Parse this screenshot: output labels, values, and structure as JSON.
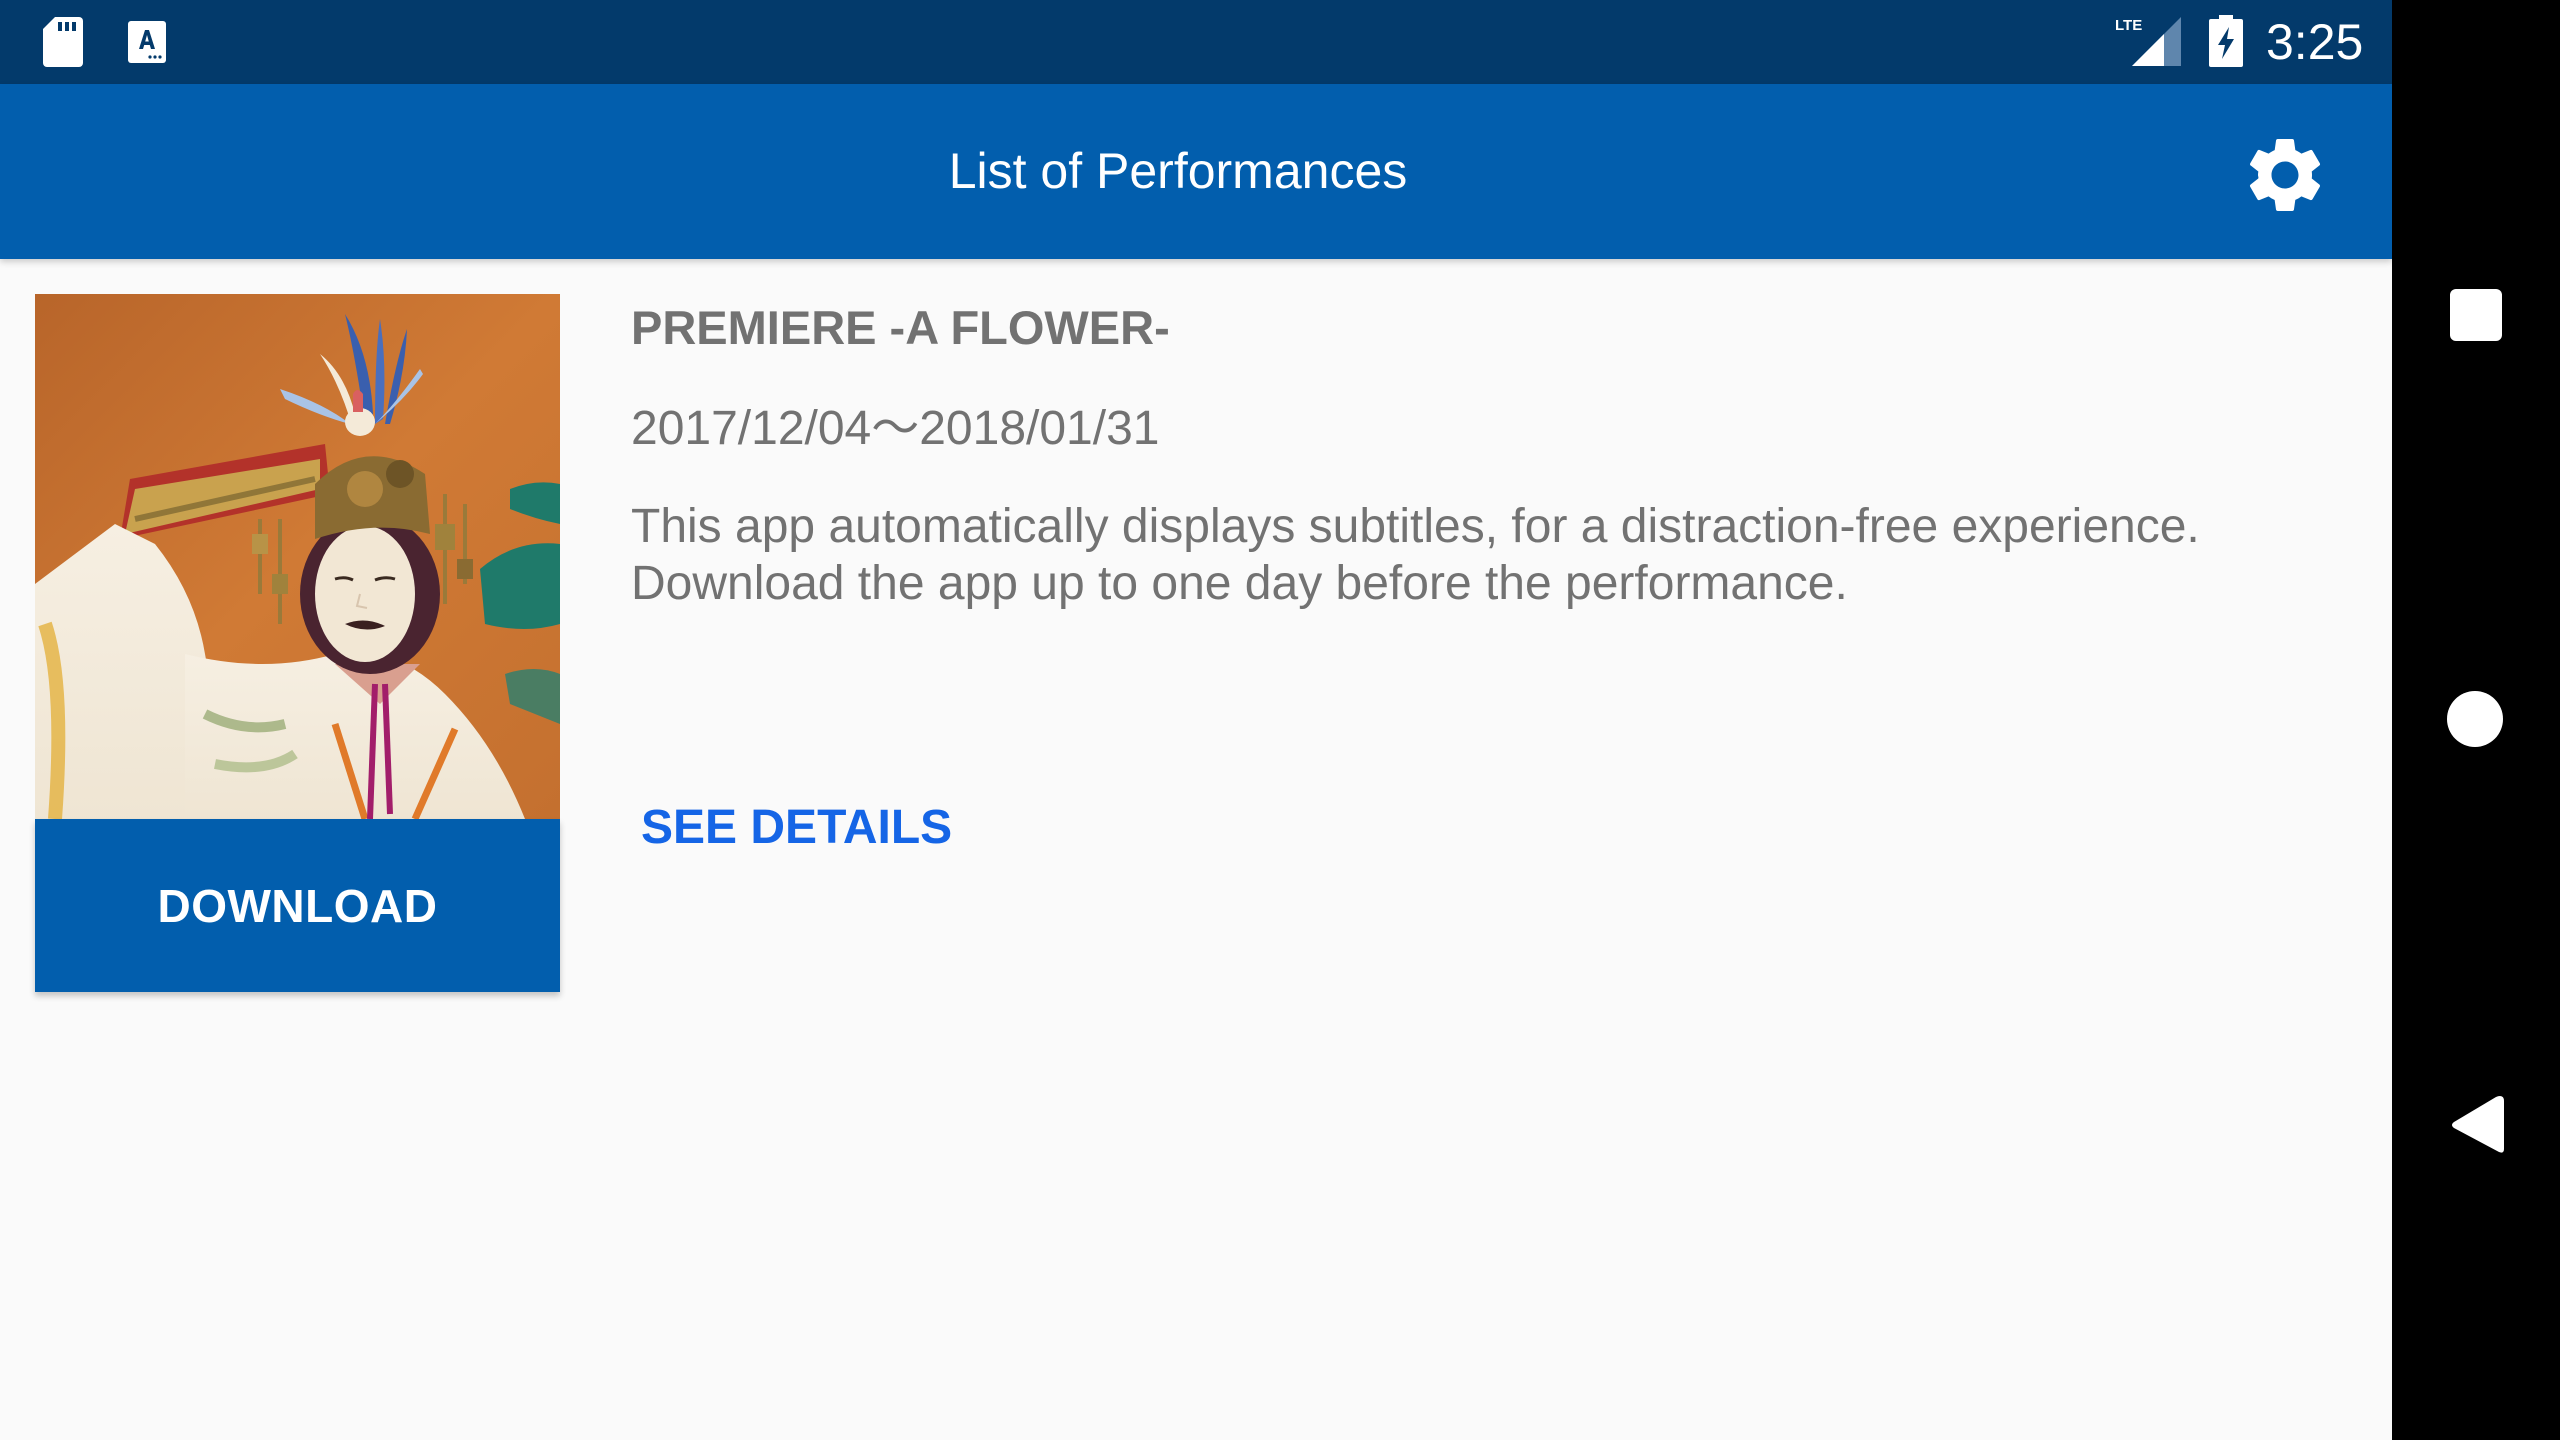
{
  "status_bar": {
    "left_icons": [
      "sd-card-icon",
      "accessibility-font-icon"
    ],
    "network_label": "LTE",
    "signal_icon": "cell-signal-icon",
    "battery_icon": "battery-charging-icon",
    "time": "3:25",
    "background_color": "#033a6b"
  },
  "app_bar": {
    "title": "List of Performances",
    "settings_icon": "gear-icon",
    "background_color": "#025ead"
  },
  "performances": [
    {
      "image_description": "Noh performer in white robe with mask, ornate headdress and folding fan",
      "title": "PREMIERE -A FLOWER-",
      "dates": "2017/12/04～2018/01/31",
      "description_lines": [
        "This app automatically displays subtitles, for a distraction-free experience.",
        "Download the app up to one day before the performance."
      ],
      "download_label": "DOWNLOAD",
      "details_label": "SEE DETAILS"
    }
  ],
  "nav_bar": {
    "buttons": [
      "recents-button",
      "home-button",
      "back-button"
    ]
  },
  "colors": {
    "primary": "#025ead",
    "link": "#1565e6",
    "text_secondary": "#727272",
    "background": "#fafafa"
  }
}
